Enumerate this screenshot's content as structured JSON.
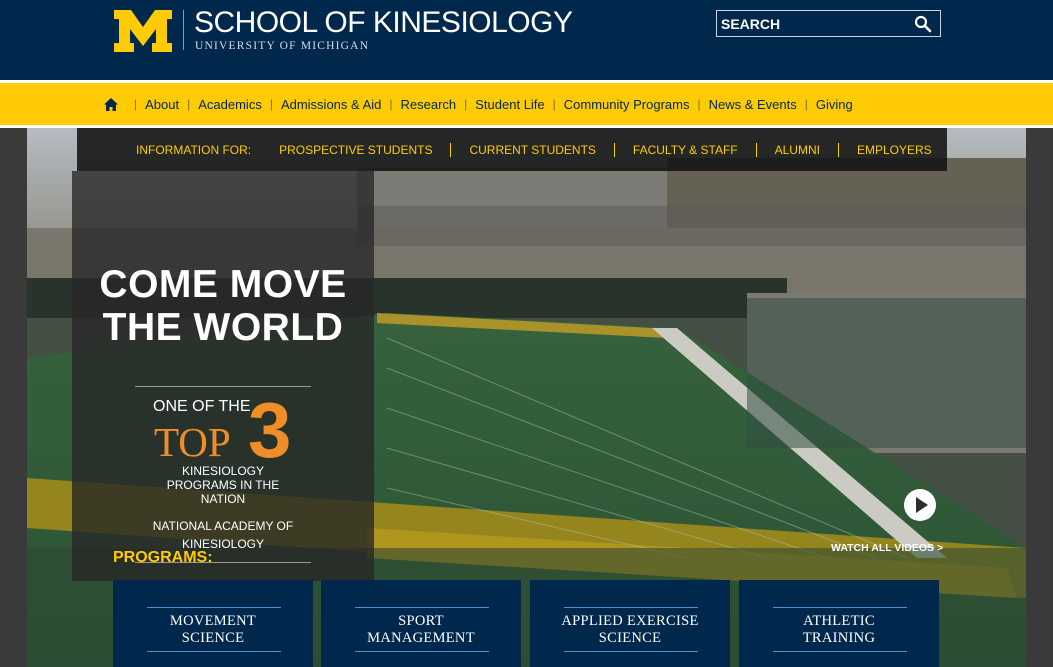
{
  "header": {
    "school_name": "SCHOOL OF KINESIOLOGY",
    "university": "UNIVERSITY OF MICHIGAN",
    "logo_icon": "block-m-logo",
    "search_placeholder": "SEARCH",
    "search_icon": "search-icon",
    "colors": {
      "navy": "#00274c",
      "maize": "#ffcb05"
    }
  },
  "nav": {
    "home_icon": "home-icon",
    "items": [
      {
        "label": "About"
      },
      {
        "label": "Academics"
      },
      {
        "label": "Admissions & Aid"
      },
      {
        "label": "Research"
      },
      {
        "label": "Student Life"
      },
      {
        "label": "Community Programs"
      },
      {
        "label": "News & Events"
      },
      {
        "label": "Giving"
      }
    ]
  },
  "info_bar": {
    "label": "INFORMATION FOR:",
    "audiences": [
      "PROSPECTIVE STUDENTS",
      "CURRENT STUDENTS",
      "FACULTY & STAFF",
      "ALUMNI",
      "EMPLOYERS"
    ]
  },
  "hero": {
    "title_line1": "COME MOVE",
    "title_line2": "THE WORLD",
    "rank_prefix": "ONE OF THE",
    "rank_top": "TOP",
    "rank_number": "3",
    "rank_desc": "KINESIOLOGY PROGRAMS IN THE NATION",
    "rank_source": "NATIONAL ACADEMY OF KINESIOLOGY",
    "programs_label": "PROGRAMS:",
    "watch_label": "WATCH ALL VIDEOS >",
    "play_icon": "play-icon",
    "accent_orange": "#ef8e28"
  },
  "programs": [
    {
      "label": "MOVEMENT\nSCIENCE"
    },
    {
      "label": "SPORT\nMANAGEMENT"
    },
    {
      "label": "APPLIED EXERCISE\nSCIENCE"
    },
    {
      "label": "ATHLETIC\nTRAINING"
    }
  ]
}
